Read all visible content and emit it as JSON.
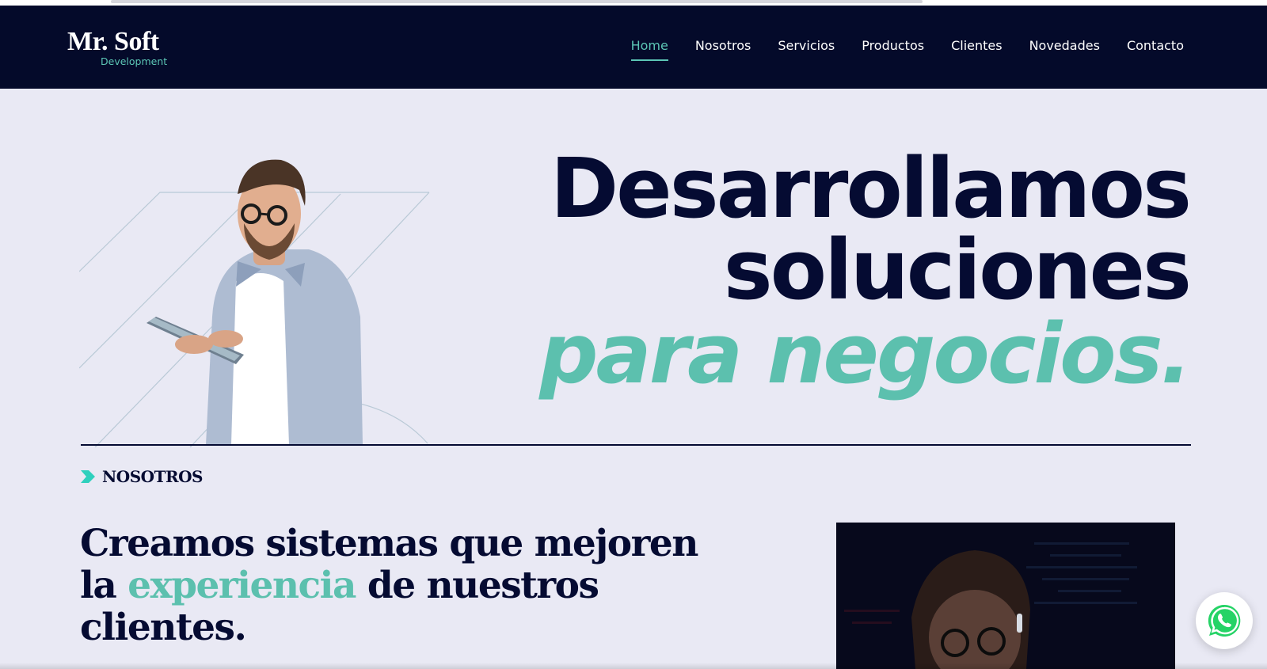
{
  "brand": {
    "name": "Mr. Soft",
    "tagline": "Development"
  },
  "nav": {
    "items": [
      {
        "label": "Home",
        "active": true
      },
      {
        "label": "Nosotros",
        "active": false
      },
      {
        "label": "Servicios",
        "active": false
      },
      {
        "label": "Productos",
        "active": false
      },
      {
        "label": "Clientes",
        "active": false
      },
      {
        "label": "Novedades",
        "active": false
      },
      {
        "label": "Contacto",
        "active": false
      }
    ]
  },
  "hero": {
    "line1": "Desarrollamos",
    "line2": "soluciones",
    "line3": "para negocios."
  },
  "about": {
    "tag": "NOSOTROS",
    "title_part1": "Creamos sistemas que mejoren la ",
    "title_accent": "experiencia",
    "title_part2": " de nuestros clientes."
  },
  "icons": {
    "whatsapp": "whatsapp-icon",
    "section_chevron": "chevron-right-icon"
  },
  "colors": {
    "navy": "#050b32",
    "header_bg": "#040a2a",
    "accent": "#5cc0ae",
    "page_bg": "#e9e9f4",
    "whatsapp_green": "#25d366"
  }
}
